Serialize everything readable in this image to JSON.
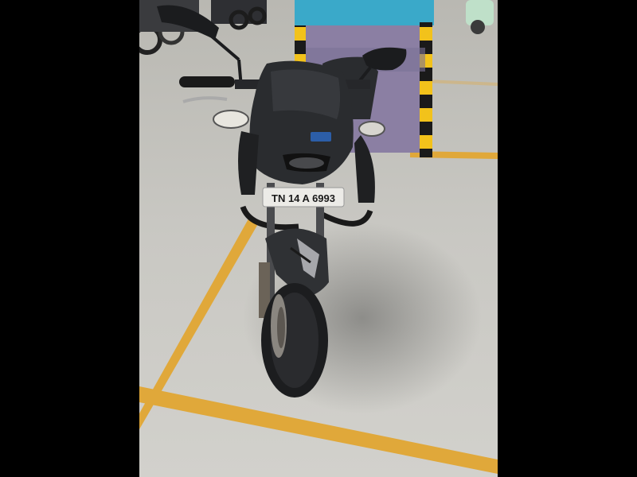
{
  "photo": {
    "subject": "motorcycle",
    "license_plate": "TN 14 A 6993",
    "colors": {
      "letterbox": "#000000",
      "floor": "#c9c8c3",
      "floor_line": "#e0a83a",
      "bike_body": "#2a2c2f",
      "pillar_purple": "#8b7fa3",
      "pillar_cyan": "#3aa9c9",
      "hazard_yellow": "#f2c21b"
    }
  }
}
